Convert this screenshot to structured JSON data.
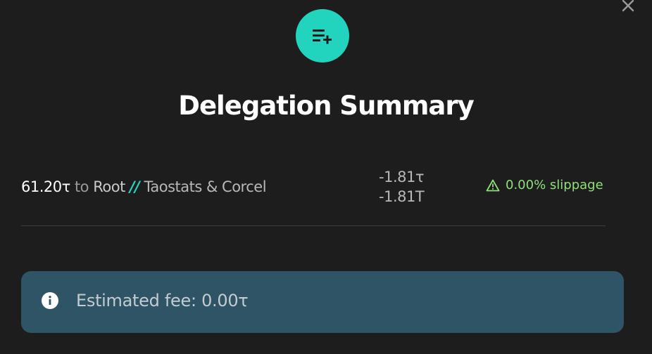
{
  "modal": {
    "title": "Delegation Summary",
    "close_icon": "close-icon",
    "header_icon": "add-to-list-icon"
  },
  "delegation": {
    "amount": "61.20τ",
    "to_word": "to",
    "target": "Root",
    "separator": "//",
    "validator": "Taostats & Corcel",
    "value_1": "-1.81τ",
    "value_2": "-1.81T",
    "slippage": "0.00% slippage",
    "slippage_icon": "warning-icon"
  },
  "fee": {
    "icon": "info-icon",
    "text": "Estimated fee: 0.00τ"
  },
  "colors": {
    "background": "#1d1d1d",
    "accent": "#22d4bd",
    "slippage_green": "#8ee07a",
    "fee_box": "#2f5465"
  }
}
